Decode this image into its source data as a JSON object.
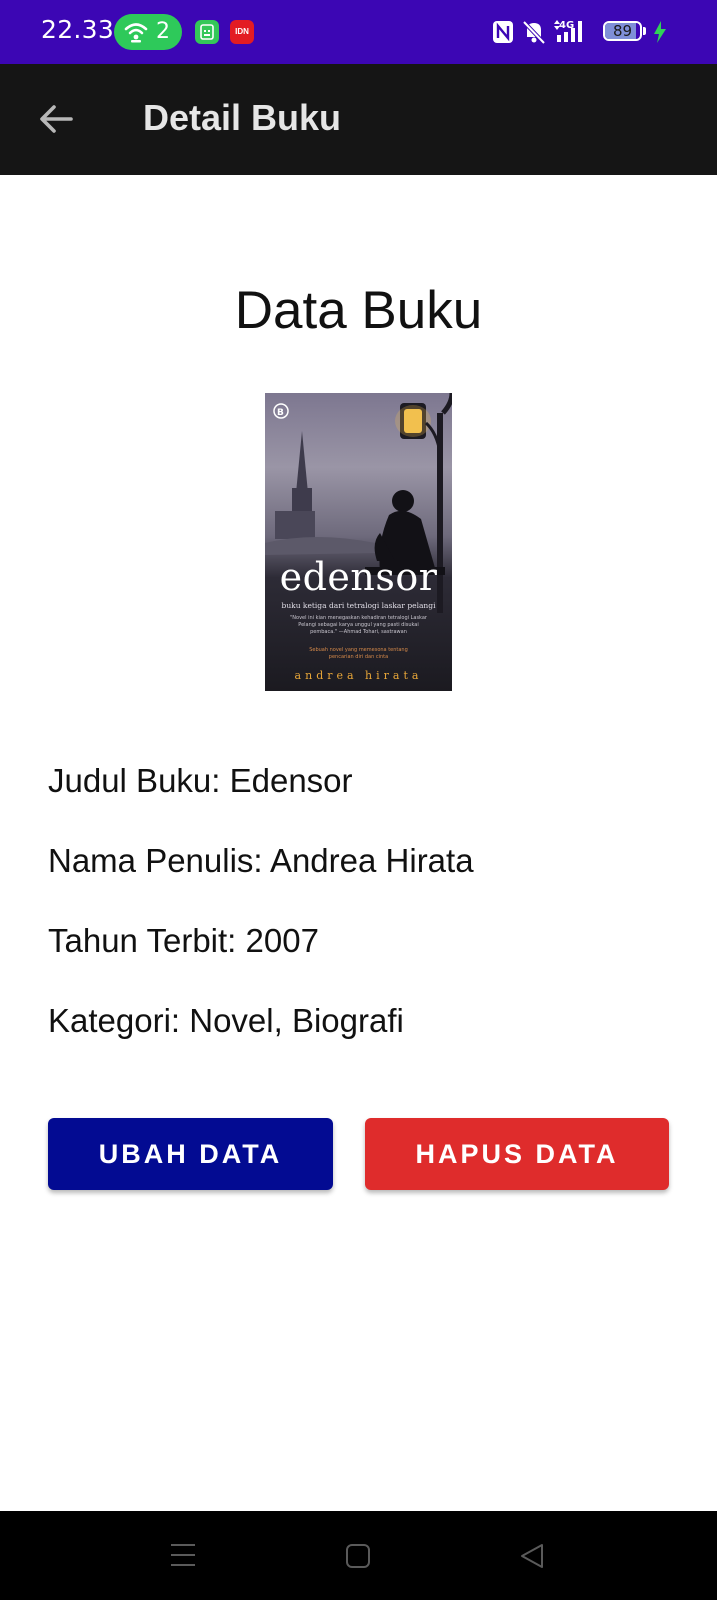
{
  "status_bar": {
    "time": "22.33",
    "hotspot_count": "2",
    "notification_badge": "IDN",
    "battery_level": "89",
    "battery_fraction": 0.89,
    "network": "4G",
    "icons": [
      "wifi-hotspot-icon",
      "app-notification-icon",
      "nfc-icon",
      "mute-icon",
      "signal-icon",
      "battery-icon",
      "charging-icon"
    ]
  },
  "app_bar": {
    "title": "Detail Buku",
    "back_icon": "arrow-left-icon"
  },
  "content": {
    "section_title": "Data Buku",
    "cover": {
      "title": "edensor",
      "subtitle": "buku ketiga dari tetralogi laskar pelangi",
      "quote": "\"Novel ini kian menegaskan kehadiran tetralogi Laskar Pelangi sebagai karya unggul yang pasti disukai pembaca.\" —Ahmad Tohari, sastrawan",
      "tagline": "Sebuah novel yang memesona tentang pencarian diri dan cinta",
      "author": "andrea hirata"
    },
    "details": [
      "Judul Buku: Edensor",
      "Nama Penulis: Andrea Hirata",
      "Tahun Terbit: 2007",
      "Kategori: Novel, Biografi"
    ]
  },
  "actions": {
    "edit_label": "UBAH DATA",
    "delete_label": "HAPUS DATA"
  },
  "colors": {
    "status_bar": "#3c06b4",
    "app_bar": "#151515",
    "edit_button": "#030b92",
    "delete_button": "#df2c2c",
    "hotspot_pill": "#2ec95a"
  },
  "nav_bar": {
    "icons": [
      "menu-icon",
      "home-icon",
      "back-triangle-icon"
    ]
  }
}
